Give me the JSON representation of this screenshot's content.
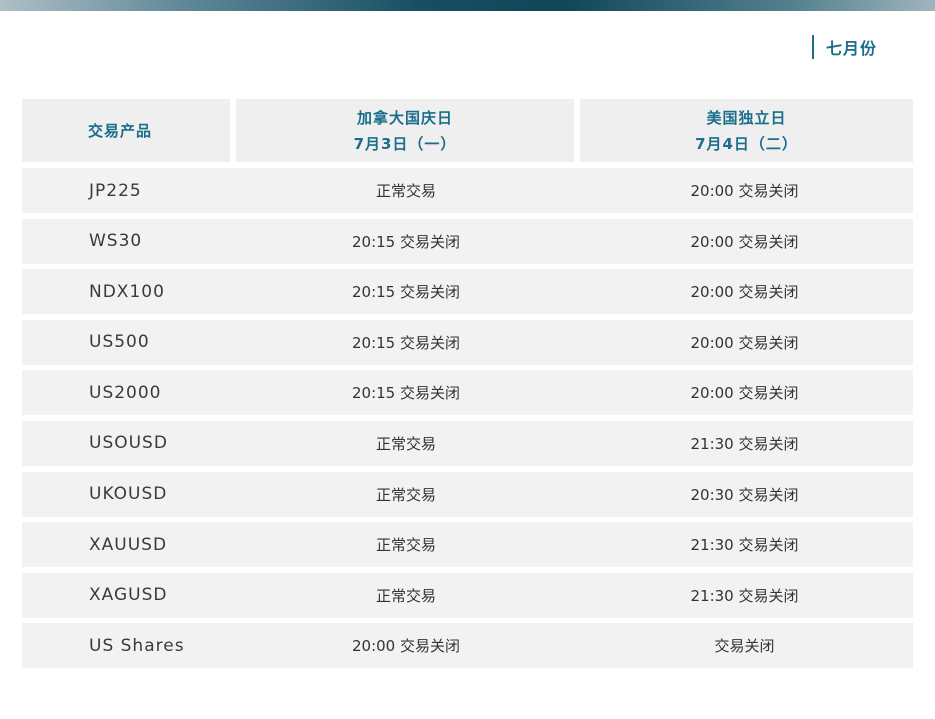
{
  "month": "七月份",
  "header": {
    "product": "交易产品",
    "holiday1": {
      "name": "加拿大国庆日",
      "date": "7月3日（一）"
    },
    "holiday2": {
      "name": "美国独立日",
      "date": "7月4日（二）"
    }
  },
  "rows": [
    {
      "product": "JP225",
      "d1": "正常交易",
      "d2": "20:00 交易关闭"
    },
    {
      "product": "WS30",
      "d1": "20:15 交易关闭",
      "d2": "20:00 交易关闭"
    },
    {
      "product": "NDX100",
      "d1": "20:15 交易关闭",
      "d2": "20:00 交易关闭"
    },
    {
      "product": "US500",
      "d1": "20:15 交易关闭",
      "d2": "20:00 交易关闭"
    },
    {
      "product": "US2000",
      "d1": "20:15 交易关闭",
      "d2": "20:00 交易关闭"
    },
    {
      "product": "USOUSD",
      "d1": "正常交易",
      "d2": "21:30 交易关闭"
    },
    {
      "product": "UKOUSD",
      "d1": "正常交易",
      "d2": "20:30 交易关闭"
    },
    {
      "product": "XAUUSD",
      "d1": "正常交易",
      "d2": "21:30 交易关闭"
    },
    {
      "product": "XAGUSD",
      "d1": "正常交易",
      "d2": "21:30 交易关闭"
    },
    {
      "product": "US Shares",
      "d1": "20:00 交易关闭",
      "d2": "交易关闭"
    }
  ],
  "colors": {
    "accent": "#1a6e8c",
    "row_bg": "#f2f2f2",
    "header_bg": "#efefef"
  }
}
